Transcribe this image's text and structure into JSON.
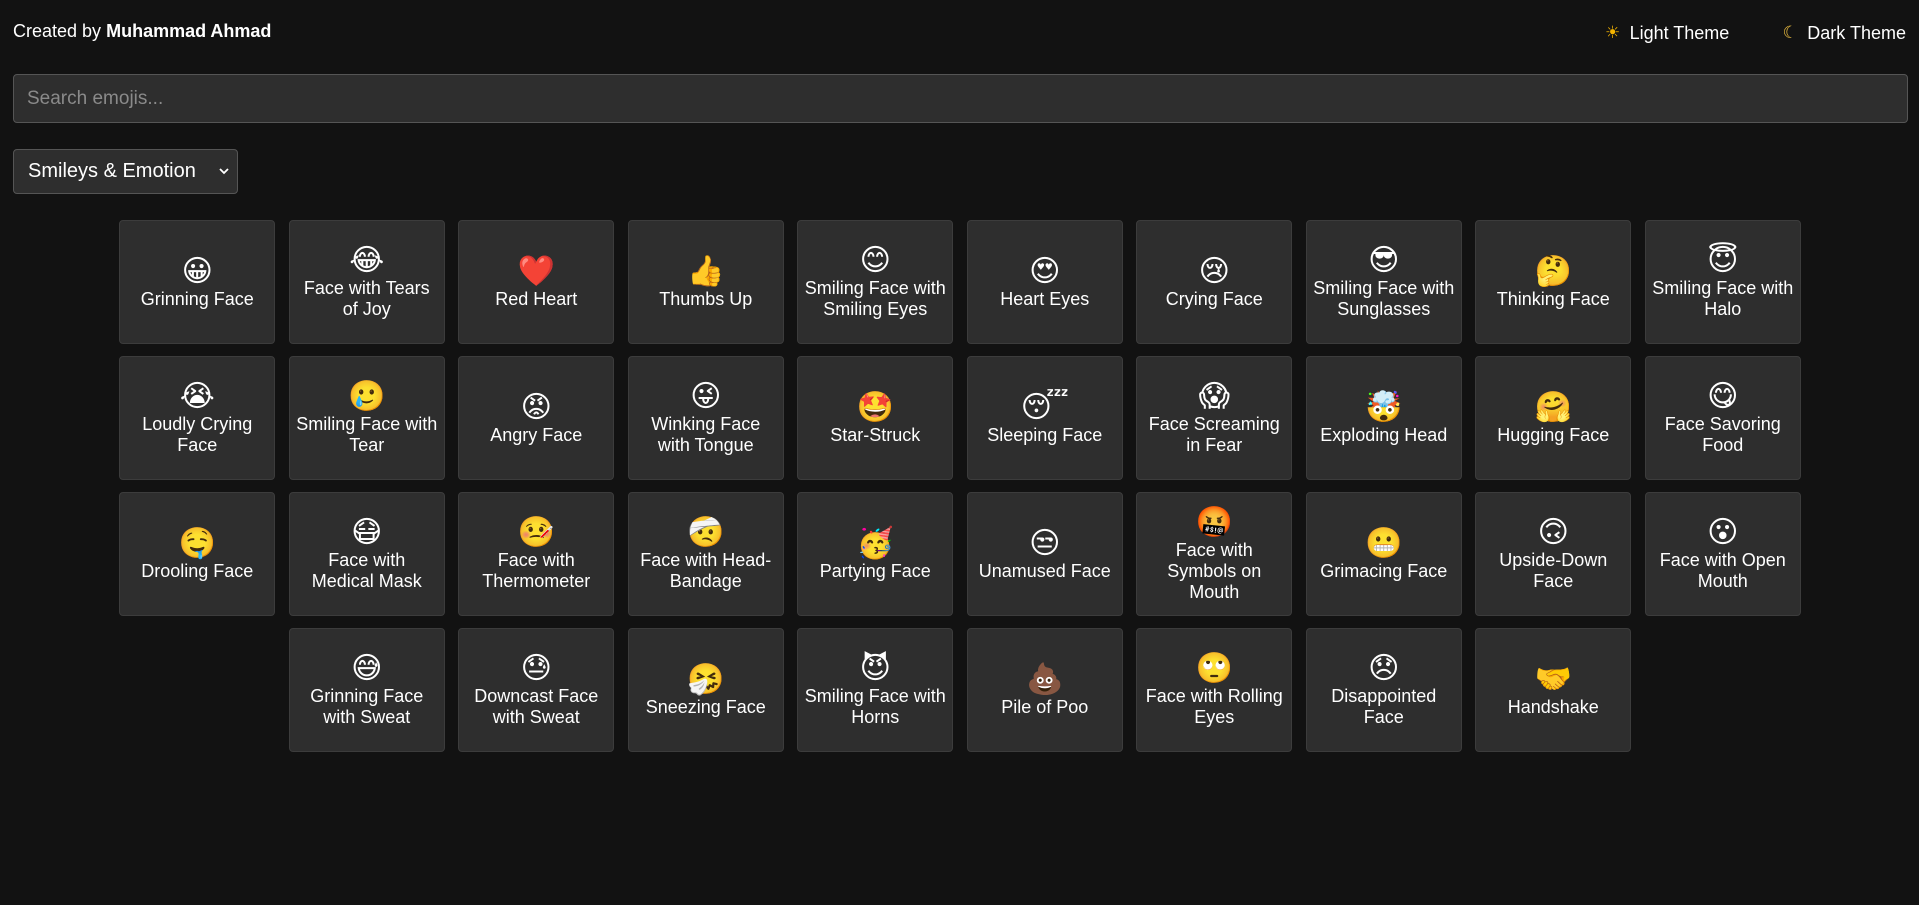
{
  "header": {
    "credit_prefix": "Created by",
    "credit_author": "Muhammad Ahmad",
    "light_theme_label": "Light Theme",
    "dark_theme_label": "Dark Theme"
  },
  "search": {
    "placeholder": "Search emojis...",
    "value": ""
  },
  "category": {
    "selected": "Smileys & Emotion"
  },
  "emojis": [
    {
      "glyph": "😀",
      "name": "Grinning Face",
      "icon": "grinning-face-icon"
    },
    {
      "glyph": "😂",
      "name": "Face with Tears of Joy",
      "icon": "tears-of-joy-icon"
    },
    {
      "glyph": "❤️",
      "name": "Red Heart",
      "icon": "red-heart-icon"
    },
    {
      "glyph": "👍",
      "name": "Thumbs Up",
      "icon": "thumbs-up-icon"
    },
    {
      "glyph": "😊",
      "name": "Smiling Face with Smiling Eyes",
      "icon": "smiling-eyes-icon"
    },
    {
      "glyph": "😍",
      "name": "Heart Eyes",
      "icon": "heart-eyes-icon"
    },
    {
      "glyph": "😢",
      "name": "Crying Face",
      "icon": "crying-face-icon"
    },
    {
      "glyph": "😎",
      "name": "Smiling Face with Sunglasses",
      "icon": "sunglasses-face-icon"
    },
    {
      "glyph": "🤔",
      "name": "Thinking Face",
      "icon": "thinking-face-icon"
    },
    {
      "glyph": "😇",
      "name": "Smiling Face with Halo",
      "icon": "halo-face-icon"
    },
    {
      "glyph": "😭",
      "name": "Loudly Crying Face",
      "icon": "loudly-crying-icon"
    },
    {
      "glyph": "🥲",
      "name": "Smiling Face with Tear",
      "icon": "smiling-tear-icon"
    },
    {
      "glyph": "😡",
      "name": "Angry Face",
      "icon": "angry-face-icon"
    },
    {
      "glyph": "😜",
      "name": "Winking Face with Tongue",
      "icon": "winking-tongue-icon"
    },
    {
      "glyph": "🤩",
      "name": "Star-Struck",
      "icon": "star-struck-icon"
    },
    {
      "glyph": "😴",
      "name": "Sleeping Face",
      "icon": "sleeping-face-icon"
    },
    {
      "glyph": "😱",
      "name": "Face Screaming in Fear",
      "icon": "screaming-face-icon"
    },
    {
      "glyph": "🤯",
      "name": "Exploding Head",
      "icon": "exploding-head-icon"
    },
    {
      "glyph": "🤗",
      "name": "Hugging Face",
      "icon": "hugging-face-icon"
    },
    {
      "glyph": "😋",
      "name": "Face Savoring Food",
      "icon": "savoring-food-icon"
    },
    {
      "glyph": "🤤",
      "name": "Drooling Face",
      "icon": "drooling-face-icon"
    },
    {
      "glyph": "😷",
      "name": "Face with Medical Mask",
      "icon": "medical-mask-icon"
    },
    {
      "glyph": "🤒",
      "name": "Face with Thermometer",
      "icon": "thermometer-face-icon"
    },
    {
      "glyph": "🤕",
      "name": "Face with Head-Bandage",
      "icon": "head-bandage-icon"
    },
    {
      "glyph": "🥳",
      "name": "Partying Face",
      "icon": "partying-face-icon"
    },
    {
      "glyph": "😒",
      "name": "Unamused Face",
      "icon": "unamused-face-icon"
    },
    {
      "glyph": "🤬",
      "name": "Face with Symbols on Mouth",
      "icon": "symbols-mouth-icon"
    },
    {
      "glyph": "😬",
      "name": "Grimacing Face",
      "icon": "grimacing-face-icon"
    },
    {
      "glyph": "🙃",
      "name": "Upside-Down Face",
      "icon": "upside-down-icon"
    },
    {
      "glyph": "😮",
      "name": "Face with Open Mouth",
      "icon": "open-mouth-icon"
    },
    {
      "glyph": "😅",
      "name": "Grinning Face with Sweat",
      "icon": "grinning-sweat-icon"
    },
    {
      "glyph": "😓",
      "name": "Downcast Face with Sweat",
      "icon": "downcast-sweat-icon"
    },
    {
      "glyph": "🤧",
      "name": "Sneezing Face",
      "icon": "sneezing-face-icon"
    },
    {
      "glyph": "😈",
      "name": "Smiling Face with Horns",
      "icon": "horns-face-icon"
    },
    {
      "glyph": "💩",
      "name": "Pile of Poo",
      "icon": "pile-of-poo-icon"
    },
    {
      "glyph": "🙄",
      "name": "Face with Rolling Eyes",
      "icon": "rolling-eyes-icon"
    },
    {
      "glyph": "😞",
      "name": "Disappointed Face",
      "icon": "disappointed-face-icon"
    },
    {
      "glyph": "🤝",
      "name": "Handshake",
      "icon": "handshake-icon"
    }
  ],
  "colors": {
    "background": "#121212",
    "card": "#2e2e2e",
    "text": "#ffffff"
  }
}
